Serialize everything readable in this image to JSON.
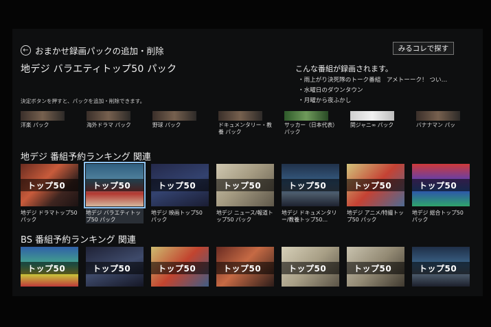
{
  "header": {
    "back_title": "おまかせ録画パックの追加・削除",
    "search_button": "みるコレで探す",
    "pack_title": "地デジ バラエティトップ50 パック",
    "instruction": "決定ボタンを押すと、パックを追加・削除できます。"
  },
  "recorded": {
    "heading": "こんな番組が録画されます。",
    "items": [
      "雨上がり決死隊のトーク番組　アメトーーク！ つい…",
      "水曜日のダウンタウン",
      "月曜から夜ふかし"
    ]
  },
  "top_packs": [
    {
      "label": "洋楽 パック"
    },
    {
      "label": "海外ドラマ パック"
    },
    {
      "label": "野球 パック"
    },
    {
      "label": "ドキュメンタリー・教養 パック"
    },
    {
      "label": "サッカー（日本代表）パック"
    },
    {
      "label": "関ジャニ∞ パック"
    },
    {
      "label": "バナナマン パッ"
    }
  ],
  "sections": {
    "terrestrial": {
      "title": "地デジ 番組予約ランキング 関連",
      "cards": [
        {
          "thumb_text": "トップ50",
          "label": "地デジ ドラマトップ50 パック"
        },
        {
          "thumb_text": "トップ50",
          "label": "地デジ バラエティトップ50 パック",
          "selected": true
        },
        {
          "thumb_text": "トップ50",
          "label": "地デジ 映画トップ50 パック"
        },
        {
          "thumb_text": "トップ50",
          "label": "地デジ ニュース/報道トップ50 パック"
        },
        {
          "thumb_text": "トップ50",
          "label": "地デジ ドキュメンタリー/教養トップ50…"
        },
        {
          "thumb_text": "トップ50",
          "label": "地デジ アニメ/特撮トップ50 パック"
        },
        {
          "thumb_text": "トップ50",
          "label": "地デジ 総合トップ50 パック"
        }
      ]
    },
    "bs": {
      "title": "BS 番組予約ランキング 関連",
      "cards": [
        {
          "thumb_text": "トップ50"
        },
        {
          "thumb_text": "トップ50"
        },
        {
          "thumb_text": "トップ50"
        },
        {
          "thumb_text": "トップ50"
        },
        {
          "thumb_text": "トップ50"
        },
        {
          "thumb_text": "トップ50"
        },
        {
          "thumb_text": "トップ50"
        }
      ]
    }
  },
  "colors": {
    "selection_outline": "#8fc4f2",
    "background": "#0e0f10"
  }
}
